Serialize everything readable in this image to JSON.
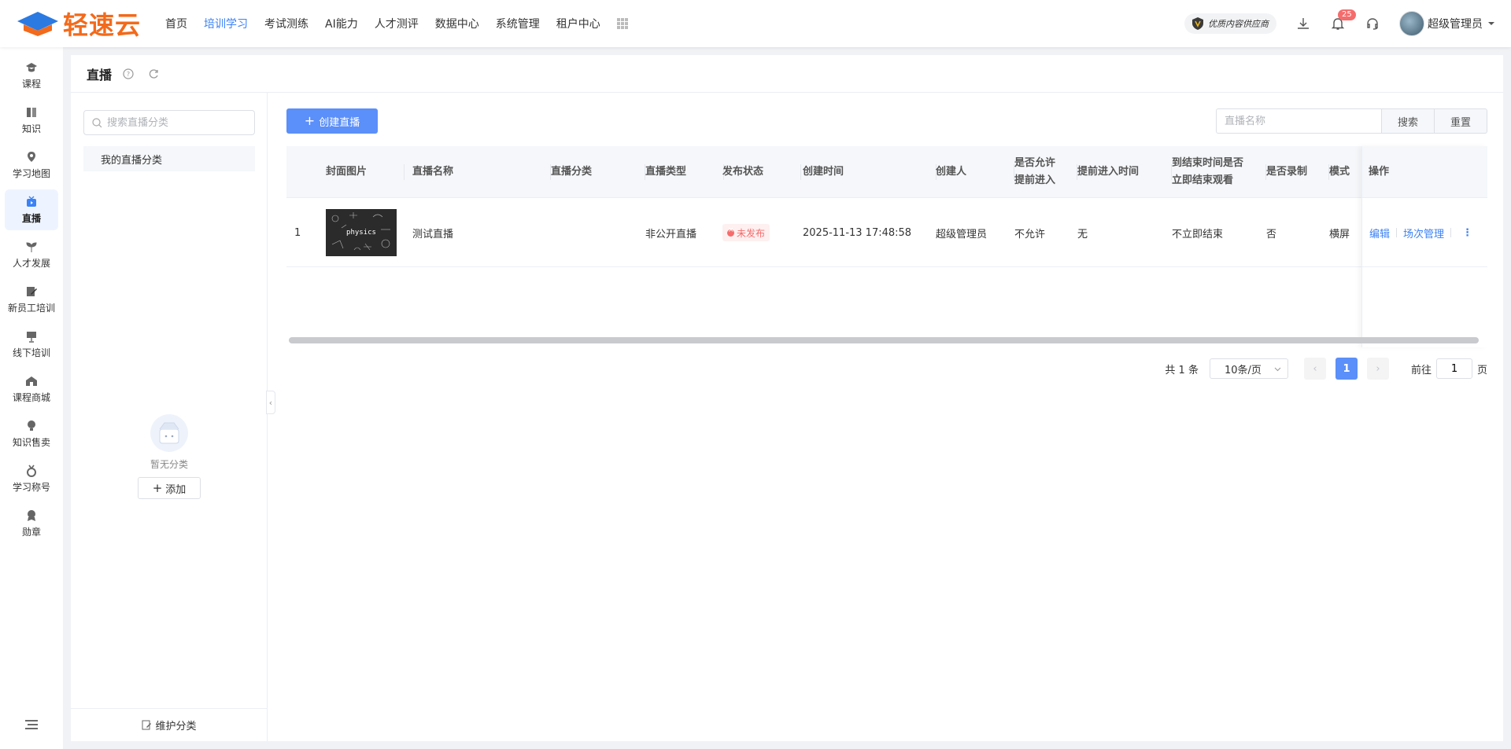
{
  "app": {
    "logo_text": "轻速云",
    "nav": [
      "首页",
      "培训学习",
      "考试测练",
      "AI能力",
      "人才测评",
      "数据中心",
      "系统管理",
      "租户中心"
    ],
    "active_nav": "培训学习",
    "supplier_badge": "优质内容供应商",
    "notification_count": "25",
    "user_name": "超级管理员",
    "accent_color": "#5b8ff9",
    "logo_color": "#f26a1b"
  },
  "sidebar": {
    "items": [
      {
        "label": "课程",
        "icon": "graduation-cap-icon"
      },
      {
        "label": "知识",
        "icon": "book-icon"
      },
      {
        "label": "学习地图",
        "icon": "map-pin-icon"
      },
      {
        "label": "直播",
        "icon": "live-tv-icon",
        "active": true
      },
      {
        "label": "人才发展",
        "icon": "sprout-icon"
      },
      {
        "label": "新员工培训",
        "icon": "edit-icon"
      },
      {
        "label": "线下培训",
        "icon": "presentation-icon"
      },
      {
        "label": "课程商城",
        "icon": "store-icon"
      },
      {
        "label": "知识售卖",
        "icon": "bulb-icon"
      },
      {
        "label": "学习称号",
        "icon": "medal-icon"
      },
      {
        "label": "勋章",
        "icon": "badge-icon"
      }
    ]
  },
  "page": {
    "title": "直播"
  },
  "categories": {
    "search_placeholder": "搜索直播分类",
    "root_item": "我的直播分类",
    "empty_text": "暂无分类",
    "add_label": "添加",
    "footer_label": "维护分类"
  },
  "toolbar": {
    "create_label": "创建直播",
    "search_placeholder": "直播名称",
    "search_label": "搜索",
    "reset_label": "重置"
  },
  "table": {
    "headers": {
      "cover": "封面图片",
      "name": "直播名称",
      "category": "直播分类",
      "type": "直播类型",
      "status": "发布状态",
      "created": "创建时间",
      "creator": "创建人",
      "early_line1": "是否允许",
      "early_line2": "提前进入",
      "early_time": "提前进入时间",
      "end_line1": "到结束时间是否",
      "end_line2": "立即结束观看",
      "record": "是否录制",
      "mode": "模式",
      "ops": "操作"
    },
    "rows": [
      {
        "index": "1",
        "cover_text": "physics",
        "name": "测试直播",
        "category": "",
        "type": "非公开直播",
        "status": "未发布",
        "created": "2025-11-13 17:48:58",
        "creator": "超级管理员",
        "allow_early": "不允许",
        "early_time": "无",
        "end_on_time": "不立即结束",
        "record": "否",
        "mode": "横屏",
        "edit_label": "编辑",
        "session_label": "场次管理"
      }
    ]
  },
  "pagination": {
    "total": "共 1 条",
    "page_size": "10条/页",
    "current_page": "1",
    "goto_prefix": "前往",
    "goto_value": "1",
    "goto_suffix": "页"
  }
}
